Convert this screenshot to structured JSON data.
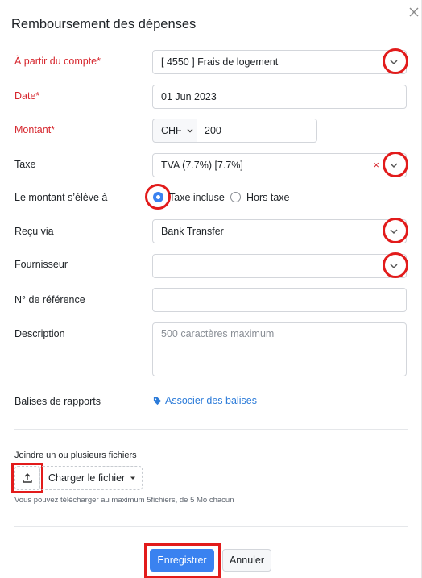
{
  "dialog": {
    "title": "Remboursement des dépenses",
    "close_icon": "close-icon"
  },
  "form": {
    "account": {
      "label": "À partir du compte*",
      "value": "[ 4550 ] Frais de logement"
    },
    "date": {
      "label": "Date*",
      "value": "01 Jun 2023"
    },
    "amount": {
      "label": "Montant*",
      "currency": "CHF",
      "value": "200"
    },
    "tax": {
      "label": "Taxe",
      "value": "TVA (7.7%) [7.7%]",
      "clear": "×"
    },
    "amount_is": {
      "label": "Le montant s’élève à",
      "option_included": "Taxe incluse",
      "option_excluded": "Hors taxe",
      "selected": "Taxe incluse"
    },
    "received_via": {
      "label": "Reçu via",
      "value": "Bank Transfer"
    },
    "supplier": {
      "label": "Fournisseur",
      "value": ""
    },
    "reference": {
      "label": "N° de référence",
      "value": ""
    },
    "description": {
      "label": "Description",
      "placeholder": "500 caractères maximum"
    },
    "report_tags": {
      "label": "Balises de rapports",
      "link": "Associer des balises"
    }
  },
  "attachments": {
    "label": "Joindre un ou plusieurs fichiers",
    "upload_button": "Charger le fichier",
    "hint": "Vous pouvez télécharger au maximum 5fichiers, de 5 Mo chacun"
  },
  "actions": {
    "save": "Enregistrer",
    "cancel": "Annuler"
  },
  "colors": {
    "accent": "#3a82f0",
    "required": "#d6262d",
    "highlight": "#e21b1b",
    "link": "#2b7bd9"
  }
}
